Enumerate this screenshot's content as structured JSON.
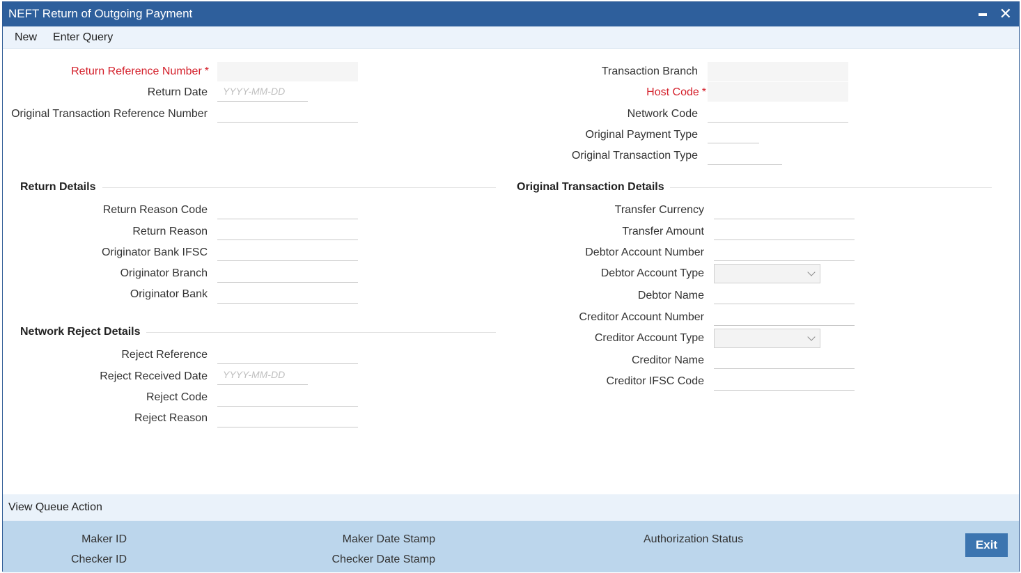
{
  "window": {
    "title": "NEFT Return of Outgoing Payment"
  },
  "menu": {
    "new": "New",
    "enter_query": "Enter Query"
  },
  "header_left": {
    "return_ref": {
      "label": "Return Reference Number",
      "required": "*"
    },
    "return_date": {
      "label": "Return Date",
      "placeholder": "YYYY-MM-DD"
    },
    "orig_txn_ref": {
      "label": "Original Transaction Reference Number"
    }
  },
  "header_right": {
    "txn_branch": {
      "label": "Transaction Branch"
    },
    "host_code": {
      "label": "Host Code",
      "required": "*"
    },
    "network_code": {
      "label": "Network Code"
    },
    "orig_payment_type": {
      "label": "Original Payment Type"
    },
    "orig_txn_type": {
      "label": "Original Transaction Type"
    }
  },
  "return_details": {
    "title": "Return Details",
    "reason_code": "Return Reason Code",
    "reason": "Return Reason",
    "orig_bank_ifsc": "Originator Bank IFSC",
    "orig_branch": "Originator Branch",
    "orig_bank": "Originator Bank"
  },
  "network_reject": {
    "title": "Network Reject Details",
    "reject_ref": "Reject Reference",
    "reject_date": "Reject Received Date",
    "reject_date_placeholder": "YYYY-MM-DD",
    "reject_code": "Reject Code",
    "reject_reason": "Reject Reason"
  },
  "orig_txn_details": {
    "title": "Original Transaction Details",
    "transfer_currency": "Transfer Currency",
    "transfer_amount": "Transfer Amount",
    "debtor_acc_no": "Debtor Account Number",
    "debtor_acc_type": "Debtor Account Type",
    "debtor_name": "Debtor Name",
    "creditor_acc_no": "Creditor Account Number",
    "creditor_acc_type": "Creditor Account Type",
    "creditor_name": "Creditor Name",
    "creditor_ifsc": "Creditor IFSC Code"
  },
  "queue": {
    "label": "View Queue Action"
  },
  "footer": {
    "maker_id": "Maker ID",
    "checker_id": "Checker ID",
    "maker_date": "Maker Date Stamp",
    "checker_date": "Checker Date Stamp",
    "auth_status": "Authorization Status",
    "exit": "Exit"
  }
}
